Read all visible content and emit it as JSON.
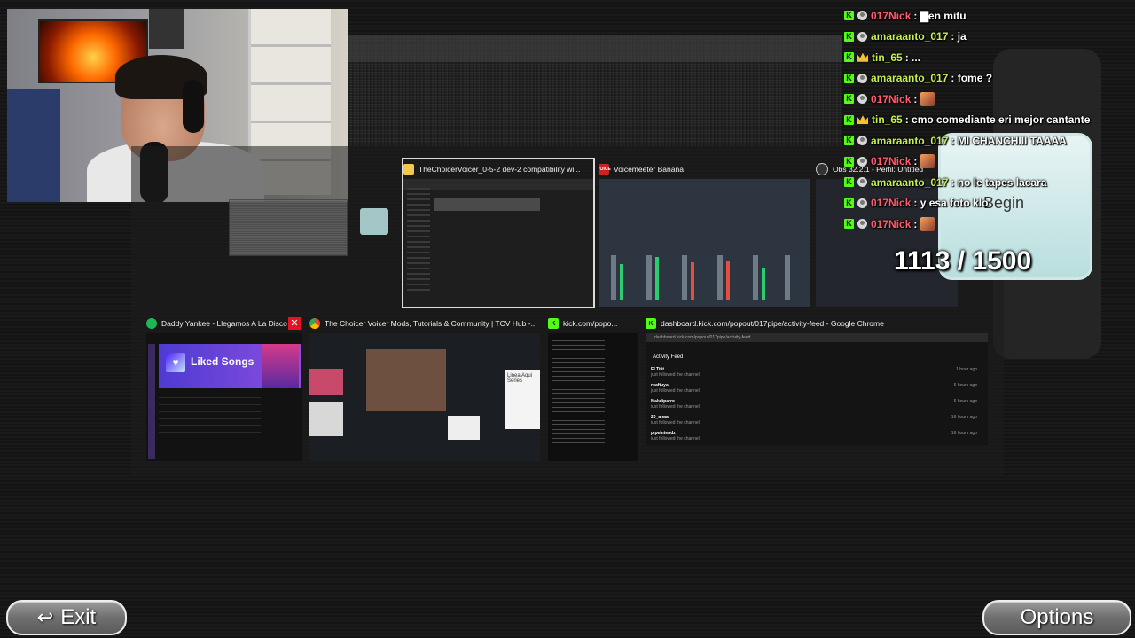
{
  "chat": {
    "messages": [
      {
        "user": "017Nick",
        "user_color": "#ff5b6e",
        "text": ": ▇en mitu",
        "badge": "user",
        "emote": false
      },
      {
        "user": "amaraanto_017",
        "user_color": "#c6f04a",
        "text": ": ja",
        "badge": "user",
        "emote": false
      },
      {
        "user": "tin_65",
        "user_color": "#c6f04a",
        "text": ": ...",
        "badge": "crown",
        "emote": false
      },
      {
        "user": "amaraanto_017",
        "user_color": "#c6f04a",
        "text": ": fome ?",
        "badge": "user",
        "emote": false
      },
      {
        "user": "017Nick",
        "user_color": "#ff5b6e",
        "text": ":",
        "badge": "user",
        "emote": true
      },
      {
        "user": "tin_65",
        "user_color": "#c6f04a",
        "text": ": cmo comediante eri mejor cantante",
        "badge": "crown",
        "emote": false
      },
      {
        "user": "amaraanto_017",
        "user_color": "#c6f04a",
        "text": ": MI CHANCHIII TAAAA",
        "badge": "user",
        "emote": false
      },
      {
        "user": "017Nick",
        "user_color": "#ff5b6e",
        "text": ":",
        "badge": "user",
        "emote": true
      },
      {
        "user": "amaraanto_017",
        "user_color": "#c6f04a",
        "text": ": no le tapes lacara",
        "badge": "user",
        "emote": false
      },
      {
        "user": "017Nick",
        "user_color": "#ff5b6e",
        "text": ": y esa foto klo",
        "badge": "user",
        "emote": false
      },
      {
        "user": "017Nick",
        "user_color": "#ff5b6e",
        "text": ":",
        "badge": "user",
        "emote": true
      }
    ]
  },
  "counter": {
    "text": "1113 / 1500",
    "begin_label": "Begin"
  },
  "windows": {
    "explorer": {
      "title": "TheChoicerVoicer_0-5-2 dev-2 compatibility wi..."
    },
    "voicemeeter": {
      "title": "Voicemeeter Banana",
      "badge": "VOICE"
    },
    "obs": {
      "title": "Obs 32.2.1 - Perfil: Untitled"
    },
    "spotify": {
      "title": "Daddy Yankee - Llegamos A La Disco",
      "liked_label": "Liked Songs"
    },
    "tcv": {
      "title": "The Choicer Voicer Mods, Tutorials & Community | TCV Hub -...",
      "card_text": "Linea Aqui Series"
    },
    "kick": {
      "title": "kick.com/popo..."
    },
    "feed": {
      "title": "dashboard.kick.com/popout/017pipe/activity-feed - Google Chrome",
      "url": "dashboard.kick.com/popout/017pipe/activity-feed",
      "header": "Activity Feed",
      "rows": [
        {
          "user": "ELTitit",
          "action": "just followed the channel",
          "ago": "1 hour ago"
        },
        {
          "user": "roaftuya",
          "action": "just followed the channel",
          "ago": "6 hours ago"
        },
        {
          "user": "Makdiparro",
          "action": "just followed the channel",
          "ago": "6 hours ago"
        },
        {
          "user": "20_anaa",
          "action": "just followed the channel",
          "ago": "16 hours ago"
        },
        {
          "user": "pipeintendz",
          "action": "just followed the channel",
          "ago": "16 hours ago"
        }
      ]
    }
  },
  "buttons": {
    "exit": "Exit",
    "options": "Options"
  },
  "colors": {
    "kick_green": "#53fc18",
    "spotify_green": "#1db954",
    "close_red": "#e81123"
  }
}
